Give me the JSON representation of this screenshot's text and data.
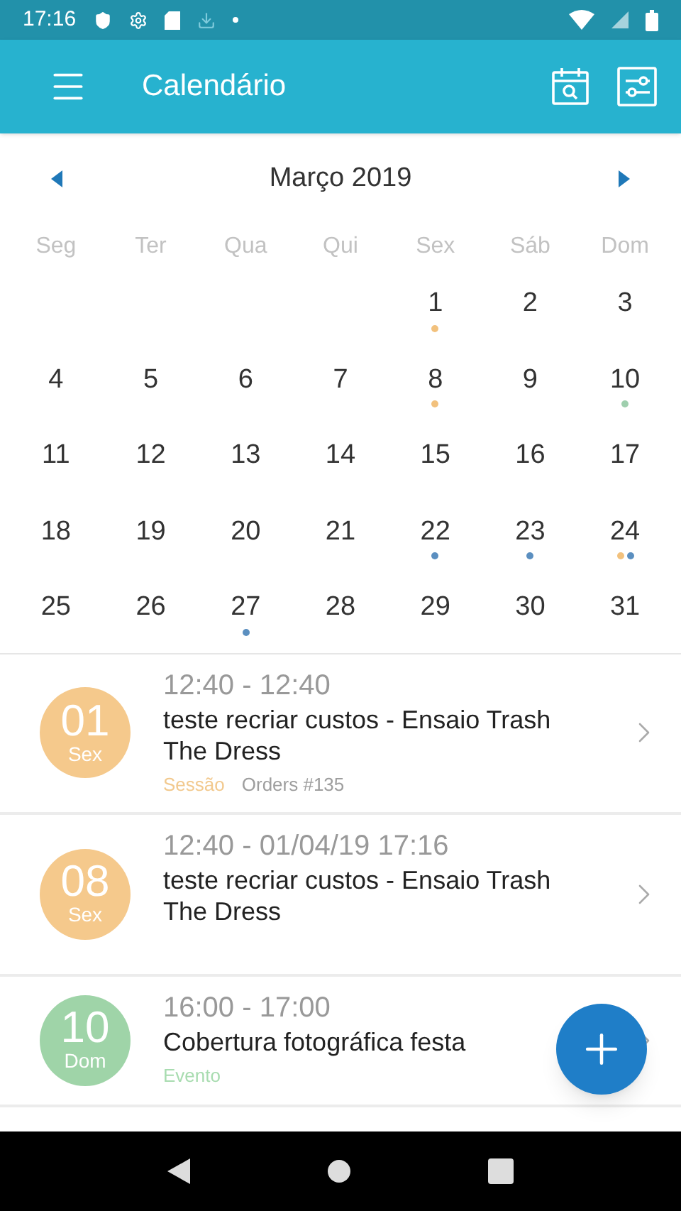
{
  "status_bar": {
    "time": "17:16"
  },
  "app_bar": {
    "title": "Calendário"
  },
  "calendar": {
    "month": "Março 2019",
    "weekdays": [
      "Seg",
      "Ter",
      "Qua",
      "Qui",
      "Sex",
      "Sáb",
      "Dom"
    ],
    "weeks": [
      {
        "kind": "partial",
        "days": [
          {
            "day": "1",
            "dots": [
              {
                "color": "#f2c17d"
              }
            ]
          },
          {
            "day": "2"
          },
          {
            "day": "3"
          }
        ]
      },
      {
        "kind": "full",
        "days": [
          {
            "day": "4"
          },
          {
            "day": "5"
          },
          {
            "day": "6"
          },
          {
            "day": "7"
          },
          {
            "day": "8",
            "dots": [
              {
                "color": "#f2c17d"
              }
            ]
          },
          {
            "day": "9"
          },
          {
            "day": "10",
            "dots": [
              {
                "color": "#9fcfae"
              }
            ]
          }
        ]
      },
      {
        "kind": "full",
        "days": [
          {
            "day": "11"
          },
          {
            "day": "12"
          },
          {
            "day": "13"
          },
          {
            "day": "14"
          },
          {
            "day": "15"
          },
          {
            "day": "16"
          },
          {
            "day": "17"
          }
        ]
      },
      {
        "kind": "full",
        "days": [
          {
            "day": "18"
          },
          {
            "day": "19"
          },
          {
            "day": "20"
          },
          {
            "day": "21"
          },
          {
            "day": "22",
            "dots": [
              {
                "color": "#5b8fc0"
              }
            ]
          },
          {
            "day": "23",
            "dots": [
              {
                "color": "#5b8fc0"
              }
            ]
          },
          {
            "day": "24",
            "dots": [
              {
                "color": "#f2c17d"
              },
              {
                "color": "#5b8fc0"
              }
            ]
          }
        ]
      },
      {
        "kind": "full",
        "days": [
          {
            "day": "25"
          },
          {
            "day": "26"
          },
          {
            "day": "27",
            "dots": [
              {
                "color": "#5b8fc0"
              }
            ]
          },
          {
            "day": "28"
          },
          {
            "day": "29"
          },
          {
            "day": "30"
          },
          {
            "day": "31"
          }
        ]
      }
    ]
  },
  "events": [
    {
      "day": "01",
      "weekday": "Sex",
      "color": "#f5c98c",
      "time": "12:40 - 12:40",
      "title": "teste recriar custos - Ensaio Trash The Dress",
      "tags": [
        {
          "text": "Sessão",
          "color": "#f2c98e"
        },
        {
          "text": "Orders #135",
          "color": "#9e9e9e"
        }
      ]
    },
    {
      "day": "08",
      "weekday": "Sex",
      "color": "#f5c98c",
      "time": "12:40 - 01/04/19 17:16",
      "title": "teste recriar custos - Ensaio Trash The Dress"
    },
    {
      "day": "10",
      "weekday": "Dom",
      "color": "#9fd4a8",
      "time": "16:00 - 17:00",
      "title": "Cobertura fotográfica festa",
      "tags": [
        {
          "text": "Evento",
          "color": "#a8dcb0"
        }
      ]
    }
  ]
}
